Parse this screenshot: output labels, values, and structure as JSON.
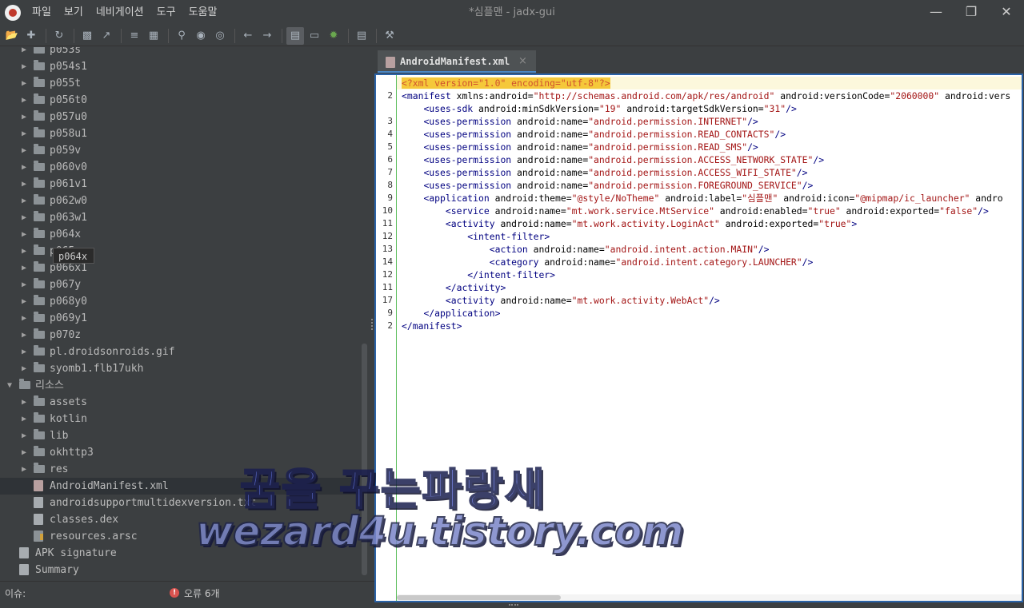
{
  "window": {
    "title": "*심플맨 - jadx-gui",
    "menu": [
      "파일",
      "보기",
      "네비게이션",
      "도구",
      "도움말"
    ],
    "controls": [
      "minimize",
      "maximize",
      "close"
    ]
  },
  "toolbar": {
    "icons": [
      "open-folder-icon",
      "add-files-icon",
      "sync-icon",
      "save-icon",
      "export-icon",
      "flatten-icon",
      "open-decomp-icon",
      "search-icon",
      "search-class-icon",
      "search-usage-icon",
      "back-icon",
      "forward-icon",
      "deobfuscation-icon",
      "quark-icon",
      "bug-icon",
      "log-icon",
      "preferences-icon"
    ]
  },
  "tree": {
    "items": [
      {
        "label": "p053s",
        "type": "folder",
        "indent": 1
      },
      {
        "label": "p054s1",
        "type": "folder",
        "indent": 1
      },
      {
        "label": "p055t",
        "type": "folder",
        "indent": 1
      },
      {
        "label": "p056t0",
        "type": "folder",
        "indent": 1
      },
      {
        "label": "p057u0",
        "type": "folder",
        "indent": 1
      },
      {
        "label": "p058u1",
        "type": "folder",
        "indent": 1
      },
      {
        "label": "p059v",
        "type": "folder",
        "indent": 1
      },
      {
        "label": "p060v0",
        "type": "folder",
        "indent": 1
      },
      {
        "label": "p061v1",
        "type": "folder",
        "indent": 1
      },
      {
        "label": "p062w0",
        "type": "folder",
        "indent": 1
      },
      {
        "label": "p063w1",
        "type": "folder",
        "indent": 1
      },
      {
        "label": "p064x",
        "type": "folder",
        "indent": 1
      },
      {
        "label": "p065",
        "type": "folder",
        "indent": 1
      },
      {
        "label": "p066x1",
        "type": "folder",
        "indent": 1
      },
      {
        "label": "p067y",
        "type": "folder",
        "indent": 1
      },
      {
        "label": "p068y0",
        "type": "folder",
        "indent": 1
      },
      {
        "label": "p069y1",
        "type": "folder",
        "indent": 1
      },
      {
        "label": "p070z",
        "type": "folder",
        "indent": 1
      },
      {
        "label": "pl.droidsonroids.gif",
        "type": "folder",
        "indent": 1
      },
      {
        "label": "syomb1.flb17ukh",
        "type": "folder",
        "indent": 1
      },
      {
        "label": "리소스",
        "type": "root-open",
        "indent": 0
      },
      {
        "label": "assets",
        "type": "folder",
        "indent": 1
      },
      {
        "label": "kotlin",
        "type": "folder",
        "indent": 1
      },
      {
        "label": "lib",
        "type": "folder",
        "indent": 1
      },
      {
        "label": "okhttp3",
        "type": "folder",
        "indent": 1
      },
      {
        "label": "res",
        "type": "folder",
        "indent": 1
      },
      {
        "label": "AndroidManifest.xml",
        "type": "xml",
        "indent": 1,
        "selected": true
      },
      {
        "label": "androidsupportmultidexversion.txt",
        "type": "file",
        "indent": 1
      },
      {
        "label": "classes.dex",
        "type": "file",
        "indent": 1
      },
      {
        "label": "resources.arsc",
        "type": "arsc",
        "indent": 1
      },
      {
        "label": "APK signature",
        "type": "file",
        "indent": 0
      },
      {
        "label": "Summary",
        "type": "file",
        "indent": 0
      }
    ],
    "tooltip": "p064x"
  },
  "editor": {
    "tab_label": "AndroidManifest.xml",
    "tab_close": "×",
    "line_numbers": [
      "",
      "2",
      "",
      "3",
      "4",
      "5",
      "6",
      "7",
      "8",
      "9",
      "10",
      "11",
      "12",
      "13",
      "14",
      "12",
      "11",
      "17",
      "9",
      "2"
    ],
    "lines": [
      "<?xml version=\"1.0\" encoding=\"utf-8\"?>",
      "<manifest xmlns:android=\"http://schemas.android.com/apk/res/android\" android:versionCode=\"2060000\" android:vers",
      "    <uses-sdk android:minSdkVersion=\"19\" android:targetSdkVersion=\"31\"/>",
      "    <uses-permission android:name=\"android.permission.INTERNET\"/>",
      "    <uses-permission android:name=\"android.permission.READ_CONTACTS\"/>",
      "    <uses-permission android:name=\"android.permission.READ_SMS\"/>",
      "    <uses-permission android:name=\"android.permission.ACCESS_NETWORK_STATE\"/>",
      "    <uses-permission android:name=\"android.permission.ACCESS_WIFI_STATE\"/>",
      "    <uses-permission android:name=\"android.permission.FOREGROUND_SERVICE\"/>",
      "    <application android:theme=\"@style/NoTheme\" android:label=\"심플맨\" android:icon=\"@mipmap/ic_launcher\" andro",
      "        <service android:name=\"mt.work.service.MtService\" android:enabled=\"true\" android:exported=\"false\"/>",
      "        <activity android:name=\"mt.work.activity.LoginAct\" android:exported=\"true\">",
      "            <intent-filter>",
      "                <action android:name=\"android.intent.action.MAIN\"/>",
      "                <category android:name=\"android.intent.category.LAUNCHER\"/>",
      "            </intent-filter>",
      "        </activity>",
      "        <activity android:name=\"mt.work.activity.WebAct\"/>",
      "    </application>",
      "</manifest>"
    ]
  },
  "status": {
    "issues_label": "이슈:",
    "errors_text": "오류 6개",
    "error_icon_glyph": "!"
  },
  "watermark": {
    "line1": "꿈을 꾸는파랑새",
    "line2": "wezard4u.tistory.com"
  }
}
